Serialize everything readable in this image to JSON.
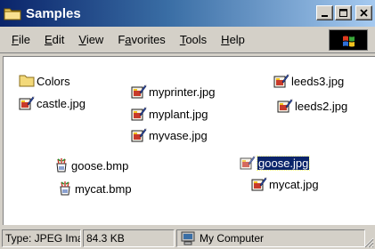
{
  "window": {
    "title": "Samples"
  },
  "menu": [
    "File",
    "Edit",
    "View",
    "Favorites",
    "Tools",
    "Help"
  ],
  "menu_underline": [
    0,
    0,
    0,
    1,
    0,
    0
  ],
  "files": [
    {
      "name": "Colors",
      "type": "folder"
    },
    {
      "name": "castle.jpg",
      "type": "jpg"
    },
    {
      "name": "myprinter.jpg",
      "type": "jpg"
    },
    {
      "name": "myplant.jpg",
      "type": "jpg"
    },
    {
      "name": "myvase.jpg",
      "type": "jpg"
    },
    {
      "name": "leeds3.jpg",
      "type": "jpg"
    },
    {
      "name": "leeds2.jpg",
      "type": "jpg"
    },
    {
      "name": "goose.bmp",
      "type": "bmp"
    },
    {
      "name": "mycat.bmp",
      "type": "bmp"
    },
    {
      "name": "goose.jpg",
      "type": "jpg",
      "selected": true
    },
    {
      "name": "mycat.jpg",
      "type": "jpg"
    }
  ],
  "status": {
    "type": "Type: JPEG Ima",
    "size": "84.3 KB",
    "zone": "My Computer"
  },
  "colors": {
    "title_start": "#0a246a",
    "title_end": "#a6caf0",
    "selection": "#0a246a",
    "face": "#d4d0c8"
  }
}
